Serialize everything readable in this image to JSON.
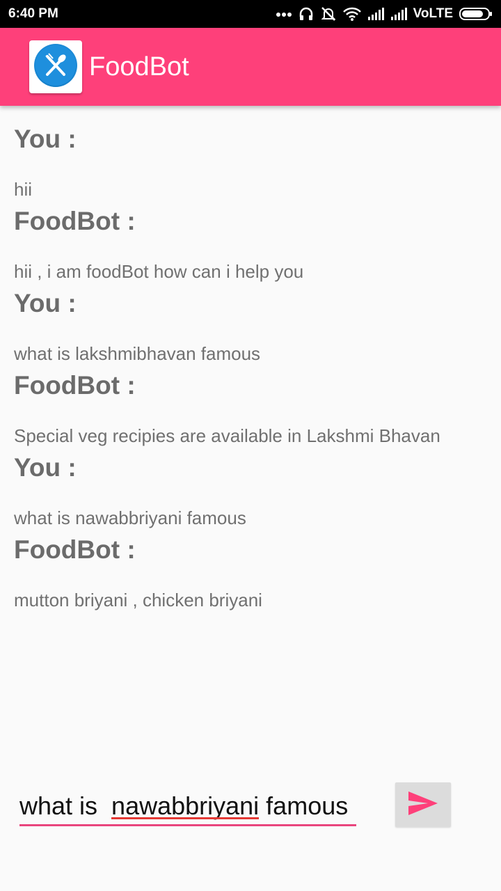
{
  "status_bar": {
    "time": "6:40 PM",
    "network": "VoLTE",
    "icons": [
      "more-dots-icon",
      "headset-icon",
      "mute-icon",
      "wifi-icon",
      "signal-icon",
      "signal-icon",
      "battery-icon"
    ]
  },
  "app_bar": {
    "title": "FoodBot",
    "logo_icon": "fork-spoon-icon",
    "bg_color": "#fe407a"
  },
  "messages": [
    {
      "sender": "You :",
      "text": "hii"
    },
    {
      "sender": "FoodBot :",
      "text": "hii , i am foodBot how can i help you"
    },
    {
      "sender": "You :",
      "text": "what is lakshmibhavan famous"
    },
    {
      "sender": "FoodBot :",
      "text": "Special veg recipies are available in Lakshmi Bhavan"
    },
    {
      "sender": "You :",
      "text": "what is nawabbriyani famous"
    },
    {
      "sender": "FoodBot :",
      "text": "mutton briyani , chicken briyani"
    }
  ],
  "composer": {
    "input_value": "what is  nawabbriyani famous",
    "send_icon": "send-icon",
    "accent_color": "#fe407a"
  }
}
